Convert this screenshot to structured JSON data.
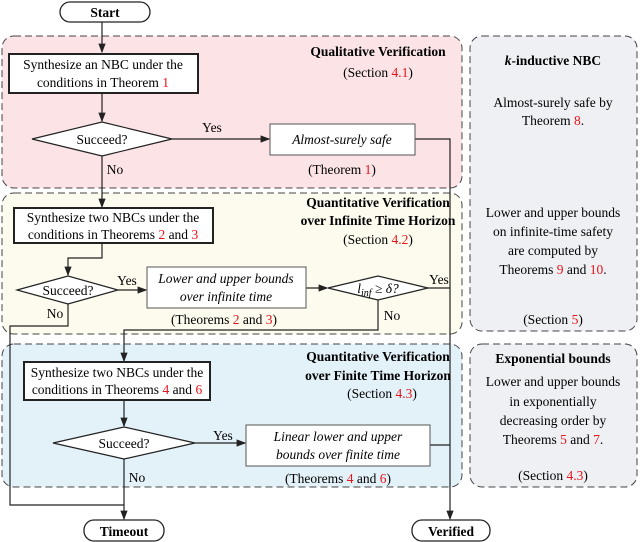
{
  "colors": {
    "qualitative": "#fbe3e6",
    "infinite": "#fdfbee",
    "finite": "#e3f1f8",
    "side": "#eef0f3",
    "ref": "#e8141c"
  },
  "terminals": {
    "start": "Start",
    "timeout": "Timeout",
    "verified": "Verified"
  },
  "qualitative": {
    "title": "Qualitative Verification",
    "section_pre": "(Section ",
    "section": "4.1",
    "section_post": ")",
    "box_l1": "Synthesize an NBC under the",
    "box_l2": "conditions in Theorem ",
    "box_ref": "1",
    "decision": "Succeed?",
    "yes": "Yes",
    "no": "No",
    "result": "Almost-surely safe",
    "cite_pre": "(Theorem ",
    "cite_ref": "1",
    "cite_post": ")"
  },
  "infinite": {
    "title_l1": "Quantitative Verification",
    "title_l2": "over Infinite Time Horizon",
    "section_pre": "(Section ",
    "section": "4.2",
    "section_post": ")",
    "box_l1": "Synthesize two NBCs under the",
    "box_l2": "conditions in Theorems ",
    "box_ref1": "2",
    "box_and": " and ",
    "box_ref2": "3",
    "decision": "Succeed?",
    "yes": "Yes",
    "no": "No",
    "result_l1": "Lower and upper bounds",
    "result_l2": "over infinite time",
    "cite_pre": "(Theorems ",
    "cite_ref1": "2",
    "cite_and": " and ",
    "cite_ref2": "3",
    "cite_post": ")",
    "check_l": "l",
    "check_sub": "inf",
    "check_rest": " ≥ δ?",
    "check_yes": "Yes",
    "check_no": "No"
  },
  "finite": {
    "title_l1": "Quantitative Verification",
    "title_l2": "over Finite Time Horizon",
    "section_pre": "(Section ",
    "section": "4.3",
    "section_post": ")",
    "box_l1": "Synthesize two NBCs under the",
    "box_l2": "conditions in Theorems ",
    "box_ref1": "4",
    "box_and": " and ",
    "box_ref2": "6",
    "decision": "Succeed?",
    "yes": "Yes",
    "no": "No",
    "result_l1": "Linear lower and upper",
    "result_l2": "bounds over finite time",
    "cite_pre": "(Theorems ",
    "cite_ref1": "4",
    "cite_and": " and ",
    "cite_ref2": "6",
    "cite_post": ")"
  },
  "side_kinductive": {
    "title_k": "k",
    "title_rest": "-inductive NBC",
    "l1": "Almost-surely safe by",
    "l2_pre": "Theorem ",
    "l2_ref": "8",
    "l2_post": ".",
    "l3": "Lower and upper bounds",
    "l4": "on infinite-time safety",
    "l5": "are computed by",
    "l6_pre": "Theorems ",
    "l6_ref1": "9",
    "l6_and": " and ",
    "l6_ref2": "10",
    "l6_post": ".",
    "section_pre": "(Section ",
    "section": "5",
    "section_post": ")"
  },
  "side_exponential": {
    "title": "Exponential bounds",
    "l1": "Lower and upper bounds",
    "l2": "in exponentially",
    "l3": "decreasing order by",
    "l4_pre": "Theorems ",
    "l4_ref1": "5",
    "l4_and": " and ",
    "l4_ref2": "7",
    "l4_post": ".",
    "section_pre": "(Section ",
    "section": "4.3",
    "section_post": ")"
  }
}
